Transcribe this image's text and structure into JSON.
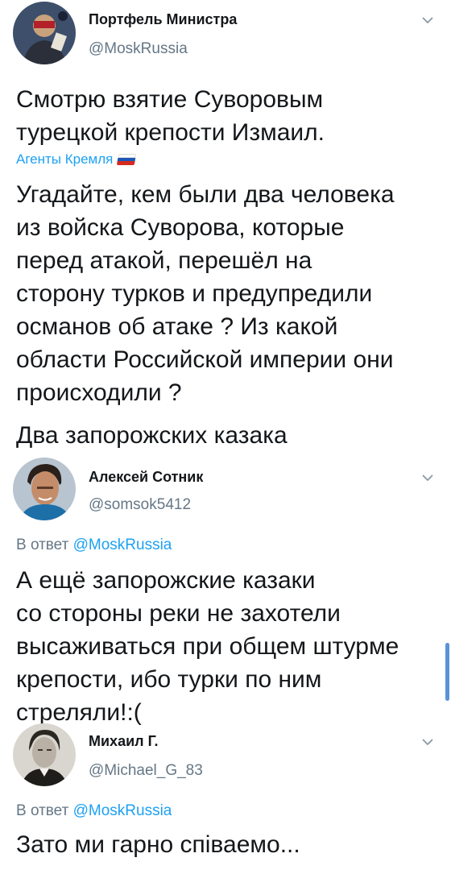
{
  "tweets": [
    {
      "author_name": "Портфель Министра",
      "handle": "@MoskRussia",
      "text_intro": "Смотрю взятие Суворовым\nтурецкой крепости Измаил.",
      "agents_label": "Агенты Кремля",
      "agents_icon": "russian-flag-icon",
      "text_question": "Угадайте, кем были два человека\nиз войска Суворова, которые\nперед атакой, перешёл на\nсторону турков и предупредили\nосманов об атаке ? Из какой\nобласти Российской империи они\nпроисходили ?",
      "text_answer": "Два запорожских казака"
    },
    {
      "author_name": "Алексей Сотник",
      "handle": "@somsok5412",
      "reply_prefix": "В ответ",
      "reply_to": "@MoskRussia",
      "text": "А ещё запорожские казаки\nсо стороны реки не захотели\nвысаживаться при общем штурме\nкрепости, ибо турки по ним\nстреляли!:("
    },
    {
      "author_name": "Михаил Г.",
      "handle": "@Michael_G_83",
      "reply_prefix": "В ответ",
      "reply_to": "@MoskRussia",
      "text": "Зато ми гарно співаемо..."
    }
  ],
  "colors": {
    "link": "#1da1f2",
    "secondary_text": "#657786",
    "primary_text": "#14171a",
    "scrollbar": "#5b93d9"
  }
}
